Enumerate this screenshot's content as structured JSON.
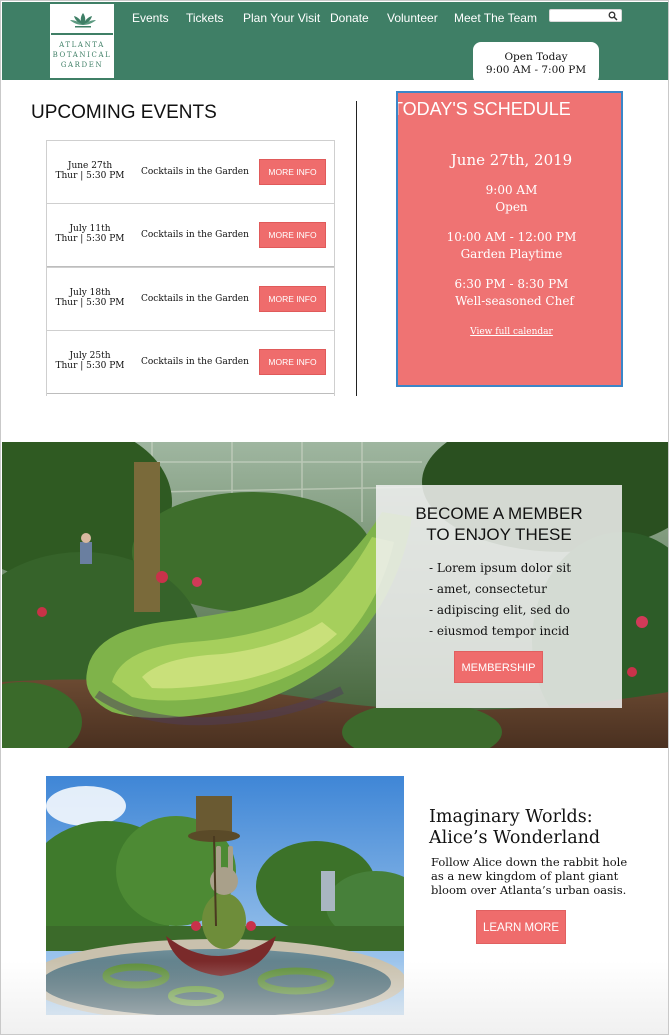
{
  "logo": {
    "lines": [
      "ATLANTA",
      "BOTANICAL",
      "GARDEN"
    ],
    "icon": "lotus-flower-icon"
  },
  "nav": {
    "items": [
      "Events",
      "Tickets",
      "Plan Your Visit",
      "Donate",
      "Volunteer",
      "Meet The Team"
    ]
  },
  "search": {
    "placeholder": "",
    "icon": "search-icon"
  },
  "open_hours": {
    "label": "Open Today",
    "hours": "9:00 AM - 7:00 PM"
  },
  "events": {
    "title": "UPCOMING EVENTS",
    "items": [
      {
        "date": "June 27th",
        "time": "Thur | 5:30 PM",
        "name": "Cocktails in the Garden",
        "button": "MORE INFO"
      },
      {
        "date": "July 11th",
        "time": "Thur | 5:30 PM",
        "name": "Cocktails in the Garden",
        "button": "MORE INFO"
      },
      {
        "date": "July 18th",
        "time": "Thur | 5:30 PM",
        "name": "Cocktails in the Garden",
        "button": "MORE INFO"
      },
      {
        "date": "July 25th",
        "time": "Thur | 5:30 PM",
        "name": "Cocktails in the Garden",
        "button": "MORE INFO"
      }
    ]
  },
  "schedule": {
    "title": "TODAY'S SCHEDULE",
    "date": "June 27th, 2019",
    "items": [
      {
        "time": "9:00 AM",
        "label": "Open"
      },
      {
        "time": "10:00 AM - 12:00 PM",
        "label": "Garden Playtime"
      },
      {
        "time": "6:30 PM - 8:30 PM",
        "label": "Well-seasoned Chef"
      }
    ],
    "link": "View full calendar"
  },
  "membership": {
    "title_lines": [
      "BECOME A MEMBER",
      "TO ENJOY THESE"
    ],
    "benefits": [
      "- Lorem ipsum dolor sit",
      "- amet, consectetur",
      "- adipiscing elit, sed do",
      "- eiusmod tempor incid"
    ],
    "button": "MEMBERSHIP"
  },
  "feature": {
    "title_lines": [
      "Imaginary Worlds:",
      "Alice’s Wonderland"
    ],
    "description_lines": [
      "Follow Alice down the rabbit hole",
      "as a new kingdom of plant giant",
      "bloom over Atlanta’s urban oasis."
    ],
    "button": "LEARN MORE"
  },
  "colors": {
    "header_green": "#3f7f66",
    "accent_coral": "#ef6c6c",
    "schedule_bg": "#ef7373",
    "selection_blue": "#3a86c8"
  }
}
